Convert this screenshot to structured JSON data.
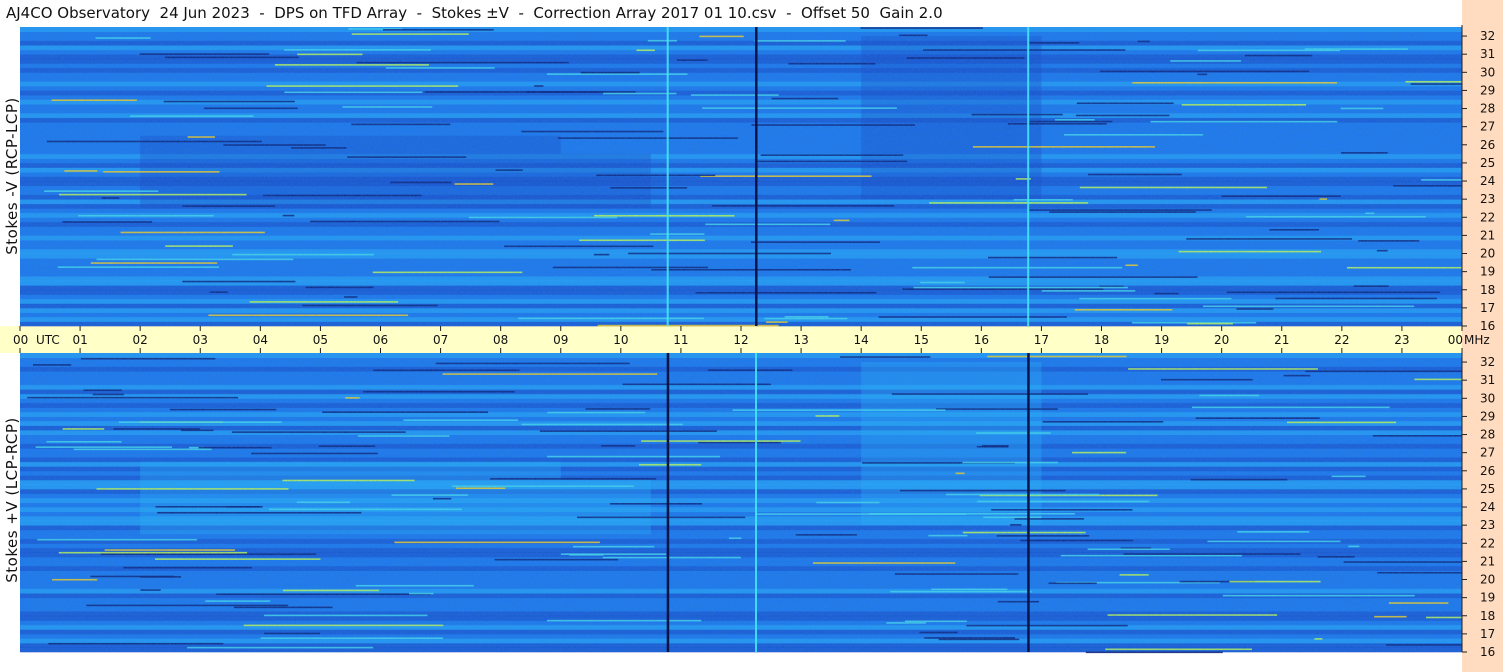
{
  "title": "AJ4CO Observatory  24 Jun 2023  -  DPS on TFD Array  -  Stokes ±V  -  Correction Array 2017 01 10.csv  -  Offset 50  Gain 2.0",
  "chart_data": [
    {
      "type": "heatmap",
      "ylabel": "Stokes -V (RCP-LCP)",
      "x_ticks": [
        "00",
        "01",
        "02",
        "03",
        "04",
        "05",
        "06",
        "07",
        "08",
        "09",
        "10",
        "11",
        "12",
        "13",
        "14",
        "15",
        "16",
        "17",
        "18",
        "19",
        "20",
        "21",
        "22",
        "23",
        "00"
      ],
      "x_unit": "UTC",
      "xlim": [
        0,
        24
      ],
      "y_ticks": [
        16,
        17,
        18,
        19,
        20,
        21,
        22,
        23,
        24,
        25,
        26,
        27,
        28,
        29,
        30,
        31,
        32
      ],
      "y_unit": "MHz",
      "ylim": [
        16,
        32.5
      ],
      "colormap": [
        "#0a1e78",
        "#1646c8",
        "#1e78f0",
        "#28b4ff",
        "#46dcf0",
        "#c8ff50",
        "#ffd21e"
      ],
      "dark_vertical_lines_utc": [
        12.25
      ],
      "bright_vertical_lines_utc": [
        10.78,
        16.78
      ]
    },
    {
      "type": "heatmap",
      "ylabel": "Stokes +V (LCP-RCP)",
      "x_ticks": [
        "00",
        "01",
        "02",
        "03",
        "04",
        "05",
        "06",
        "07",
        "08",
        "09",
        "10",
        "11",
        "12",
        "13",
        "14",
        "15",
        "16",
        "17",
        "18",
        "19",
        "20",
        "21",
        "22",
        "23",
        "00"
      ],
      "x_unit": "UTC",
      "xlim": [
        0,
        24
      ],
      "y_ticks": [
        16,
        17,
        18,
        19,
        20,
        21,
        22,
        23,
        24,
        25,
        26,
        27,
        28,
        29,
        30,
        31,
        32
      ],
      "y_unit": "MHz",
      "ylim": [
        16,
        32.5
      ],
      "colormap": [
        "#0a1e78",
        "#1646c8",
        "#1e78f0",
        "#28b4ff",
        "#46dcf0",
        "#c8ff50",
        "#ffd21e"
      ],
      "dark_vertical_lines_utc": [
        10.78,
        16.78
      ],
      "bright_vertical_lines_utc": [
        12.25
      ]
    }
  ]
}
